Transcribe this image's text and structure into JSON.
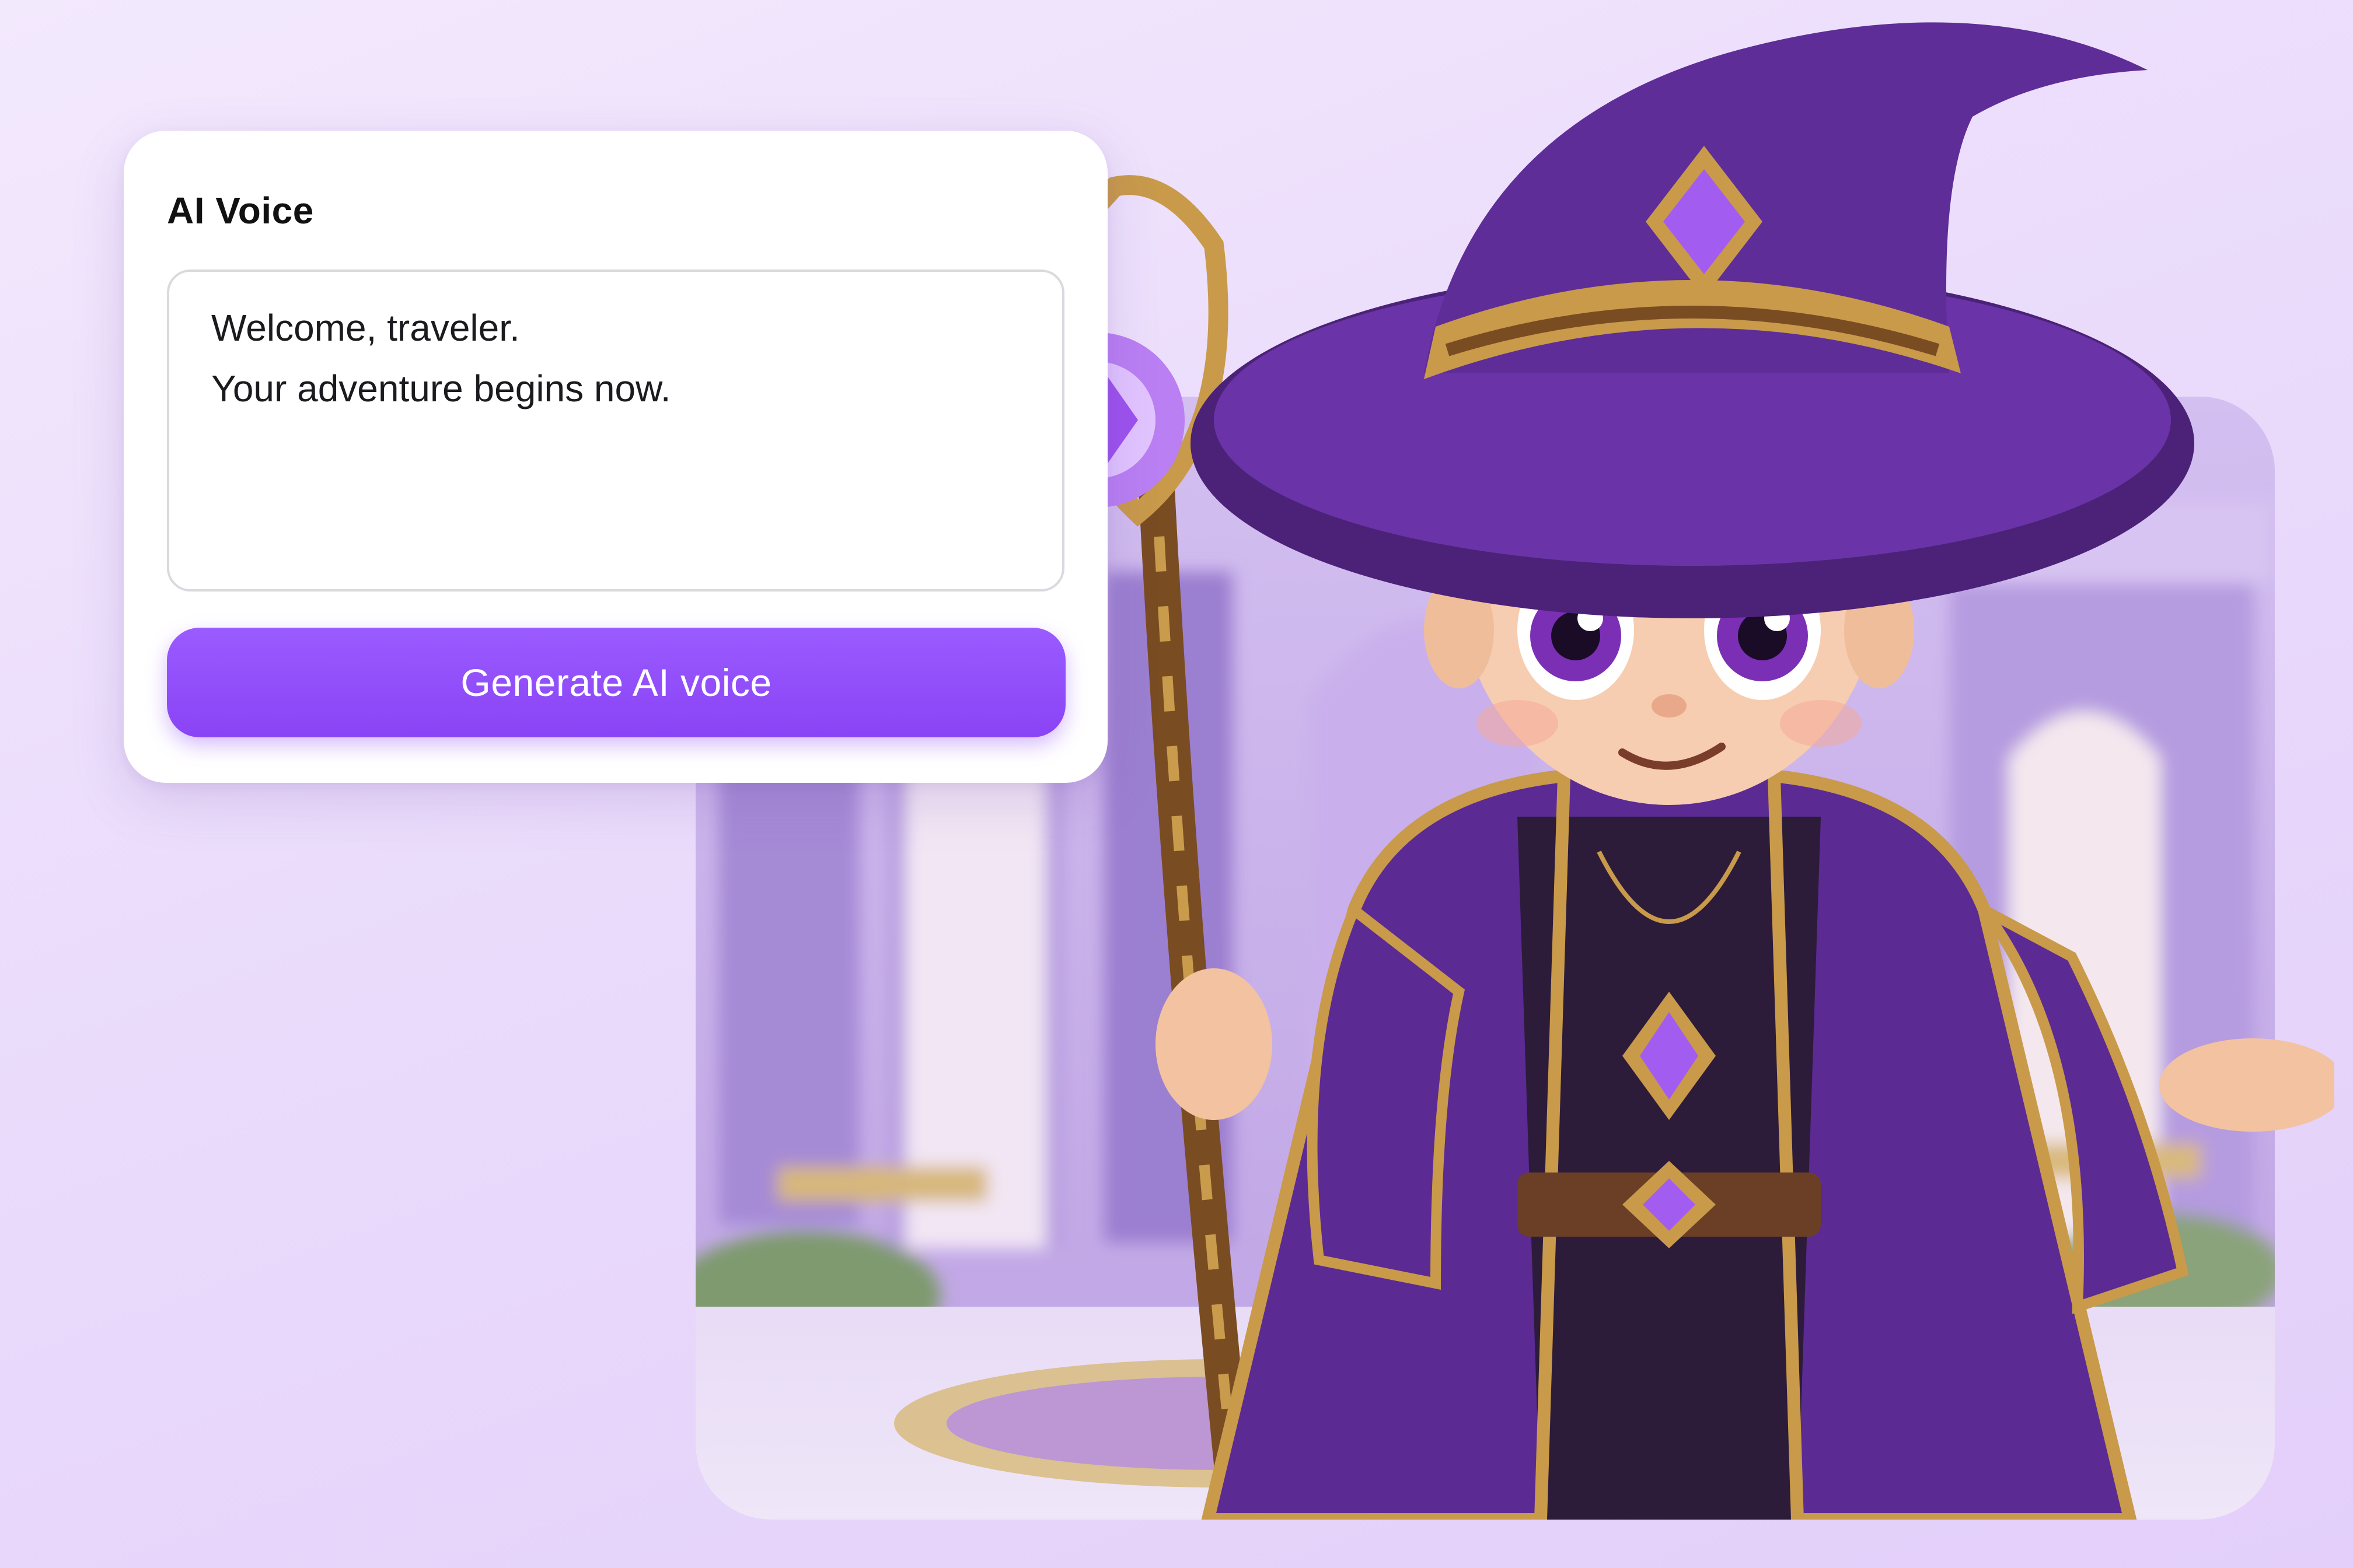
{
  "voice_card": {
    "title": "AI Voice",
    "text_lines": [
      "Welcome, traveler.",
      "Your adventure begins now."
    ],
    "button_label": "Generate AI voice"
  },
  "illustration": {
    "subject": "wizard-character",
    "colors": {
      "accent": "#8a43f5",
      "robe": "#5b2a93",
      "gold": "#c89a4a",
      "gem": "#a35cf0",
      "page_background": "#eadbfb"
    }
  }
}
